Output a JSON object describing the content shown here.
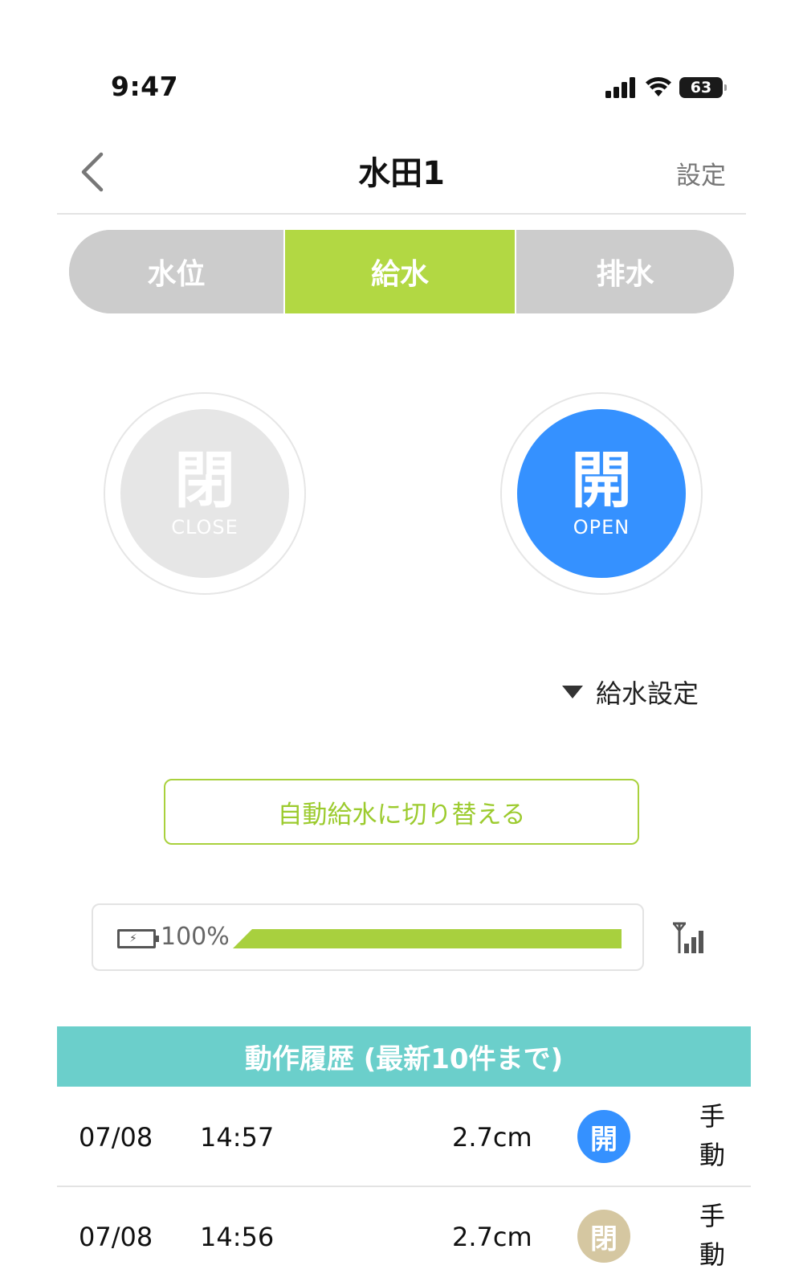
{
  "status_bar": {
    "time": "9:47",
    "battery": "63"
  },
  "nav": {
    "title": "水田1",
    "settings": "設定"
  },
  "tabs": [
    {
      "label": "水位",
      "active": false
    },
    {
      "label": "給水",
      "active": true
    },
    {
      "label": "排水",
      "active": false
    }
  ],
  "valves": {
    "close": {
      "kanji": "閉",
      "label": "CLOSE"
    },
    "open": {
      "kanji": "開",
      "label": "OPEN",
      "active": true
    }
  },
  "supply_settings": {
    "label": "給水設定"
  },
  "auto_switch": {
    "label": "自動給水に切り替える"
  },
  "device": {
    "battery_percent": "100%",
    "battery_level": 1.0
  },
  "history": {
    "title": "動作履歴 (最新10件まで)",
    "rows": [
      {
        "date": "07/08",
        "time": "14:57",
        "level": "2.7cm",
        "action": "開",
        "action_state": "open",
        "mode": "手動"
      },
      {
        "date": "07/08",
        "time": "14:56",
        "level": "2.7cm",
        "action": "閉",
        "action_state": "close",
        "mode": "手動"
      }
    ]
  },
  "colors": {
    "accent_green": "#b2d843",
    "open_blue": "#3591ff",
    "close_beige": "#d5c7a1",
    "history_header": "#6bcfcb"
  },
  "icons": {
    "back": "chevron-left-icon",
    "signal": "antenna-signal-icon",
    "battery": "battery-charging-icon",
    "wifi": "wifi-icon",
    "cellular": "cellular-signal-icon"
  }
}
